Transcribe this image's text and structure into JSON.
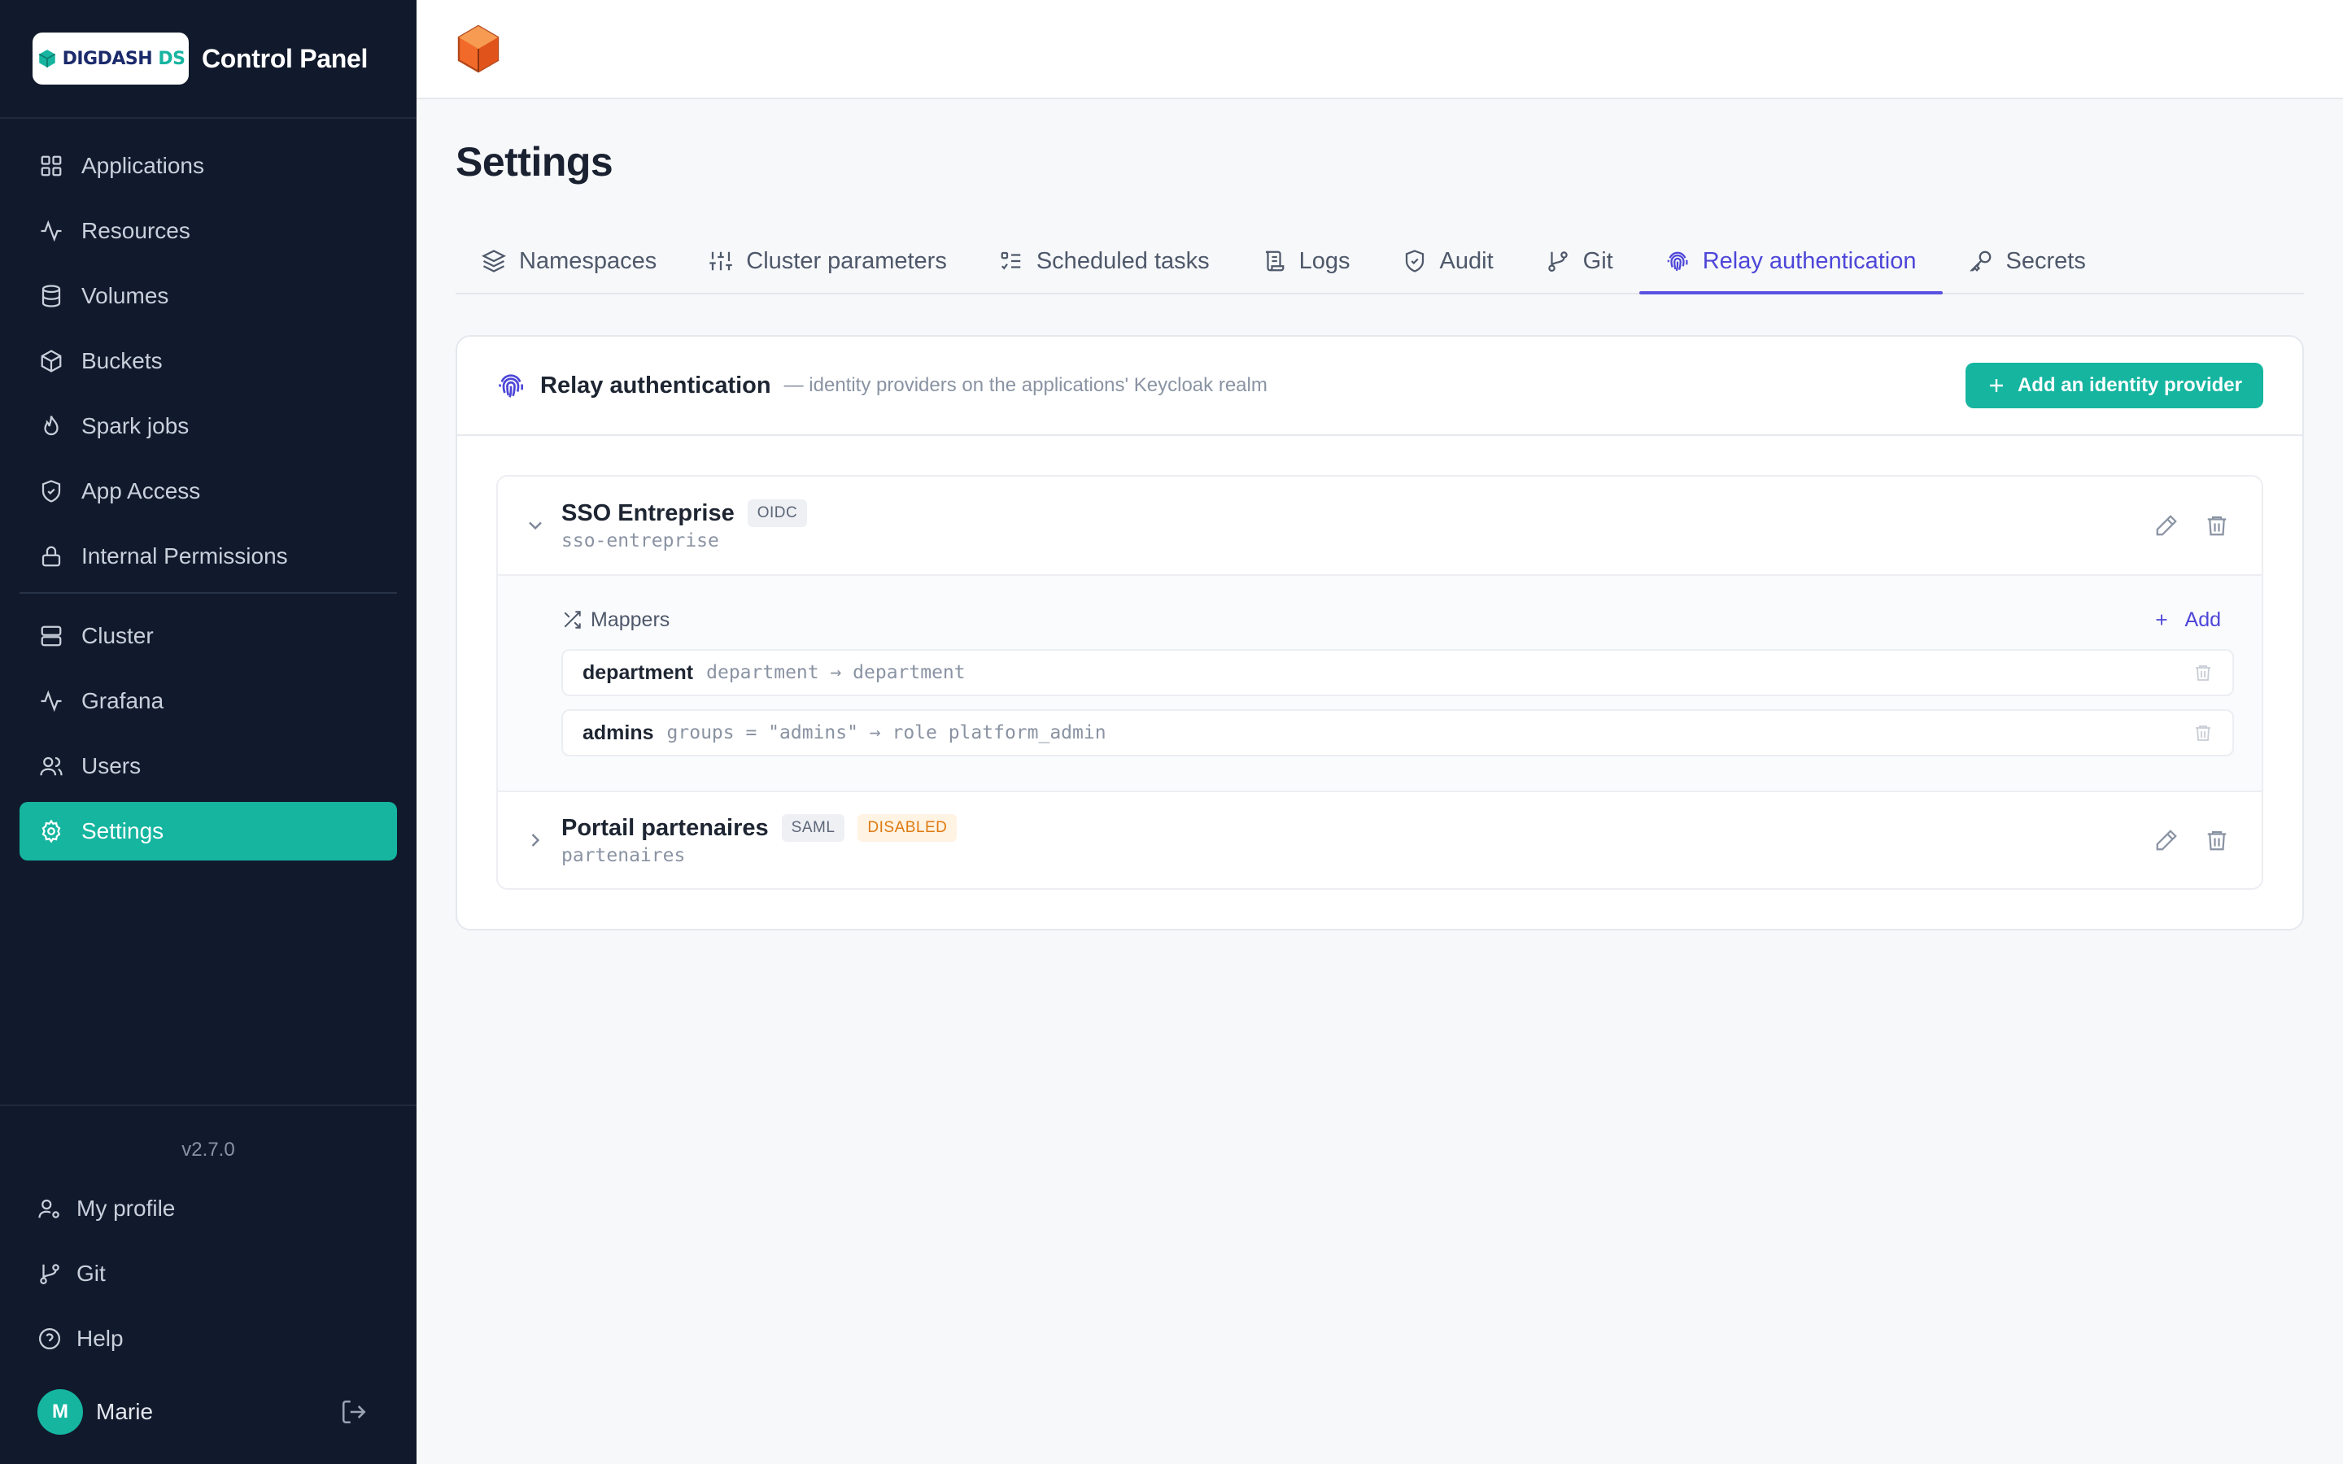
{
  "brand": {
    "logo_word": "DIGDASH",
    "logo_suffix": "DS",
    "title": "Control Panel"
  },
  "sidebar": {
    "items": [
      {
        "label": "Applications",
        "icon": "grid-icon"
      },
      {
        "label": "Resources",
        "icon": "activity-icon"
      },
      {
        "label": "Volumes",
        "icon": "database-icon"
      },
      {
        "label": "Buckets",
        "icon": "box-icon"
      },
      {
        "label": "Spark jobs",
        "icon": "flame-icon"
      },
      {
        "label": "App Access",
        "icon": "shield-icon"
      },
      {
        "label": "Internal Permissions",
        "icon": "lock-icon"
      },
      {
        "label": "Cluster",
        "icon": "server-icon"
      },
      {
        "label": "Grafana",
        "icon": "activity-icon"
      },
      {
        "label": "Users",
        "icon": "users-icon"
      },
      {
        "label": "Settings",
        "icon": "gear-icon",
        "active": true
      }
    ],
    "version": "v2.7.0",
    "bottom": [
      {
        "label": "My profile",
        "icon": "user-cog-icon"
      },
      {
        "label": "Git",
        "icon": "git-branch-icon"
      },
      {
        "label": "Help",
        "icon": "help-circle-icon"
      }
    ],
    "user": {
      "initial": "M",
      "name": "Marie"
    }
  },
  "page": {
    "title": "Settings",
    "tabs": [
      {
        "label": "Namespaces",
        "icon": "layers-icon"
      },
      {
        "label": "Cluster parameters",
        "icon": "sliders-icon"
      },
      {
        "label": "Scheduled tasks",
        "icon": "list-checks-icon"
      },
      {
        "label": "Logs",
        "icon": "scroll-icon"
      },
      {
        "label": "Audit",
        "icon": "shield-check-icon"
      },
      {
        "label": "Git",
        "icon": "git-branch-icon"
      },
      {
        "label": "Relay authentication",
        "icon": "fingerprint-icon",
        "active": true
      },
      {
        "label": "Secrets",
        "icon": "key-icon"
      }
    ]
  },
  "card": {
    "title": "Relay authentication",
    "subtitle": "— identity providers on the applications' Keycloak realm",
    "add_button": "Add an identity provider"
  },
  "providers": [
    {
      "name": "SSO Entreprise",
      "type": "OIDC",
      "slug": "sso-entreprise",
      "expanded": true,
      "mappers_title": "Mappers",
      "add_label": "Add",
      "mappers": [
        {
          "name": "department",
          "rule": "department → department"
        },
        {
          "name": "admins",
          "rule": "groups = \"admins\" → role platform_admin"
        }
      ]
    },
    {
      "name": "Portail partenaires",
      "type": "SAML",
      "status": "DISABLED",
      "slug": "partenaires",
      "expanded": false
    }
  ],
  "colors": {
    "sidebar_bg": "#111a2c",
    "accent": "#15b5a0",
    "tab_active": "#4d46d8",
    "warning": "#de7a10"
  }
}
